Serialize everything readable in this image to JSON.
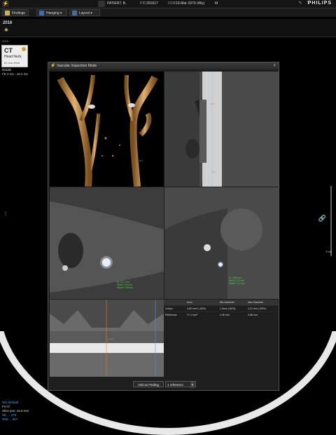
{
  "topbar": {
    "patient_name": "PATIENT, B.",
    "pid_label": "PID",
    "pid_value": "201617",
    "dob_label": "DOB",
    "dob_value": "10-Mar-1970 (46y)",
    "sex": "M",
    "brand": "PHILIPS",
    "help": "?"
  },
  "toolbar": {
    "findings": "Findings",
    "hanging": "Hanging",
    "layout": "Layout"
  },
  "timeline": {
    "year": "2016",
    "sub_year": "2016"
  },
  "study": {
    "modality": "CT",
    "desc": "Head Neck",
    "date": "01 Jun 2016"
  },
  "overlay_top": {
    "line1": "DIS2D",
    "line2": "FE 2 ms - 18.4 ms"
  },
  "overlay_bottom": {
    "wl": "W/L Default",
    "fh": "FH 0°",
    "slice": "Slice pos: 16.9 mm",
    "wl_val": "WL ... 379",
    "ww_val": "WW ... 867"
  },
  "scale_label": "5 cm",
  "dialog": {
    "title": "Vascular Inspection Mode",
    "close": "×",
    "pane_labels": {
      "mpr_blue": "Ref",
      "mpr_orange": "Lesion",
      "lower_orange": "Lesion"
    },
    "cross_left": [
      "Ar: 12.3 mm²",
      "MinØ: 3.96 mm",
      "MaxØ: 3.98 mm"
    ],
    "cross_right": [
      "Ar: 3.89 mm²",
      "MinØ: 2.21 mm",
      "MaxØ: 2.21 mm"
    ],
    "table": {
      "headers": [
        "",
        "Area",
        "Min Diameter",
        "Max Diameter"
      ],
      "rows": [
        [
          "Lesion",
          "3.89 mm² (-82%)",
          "1.8mm (-60%)",
          "2.21 mm (-55%)"
        ],
        [
          "Reference",
          "17.1 mm²",
          "4.46 mm",
          "4.86 mm"
        ]
      ]
    },
    "add_finding": "Add as Finding",
    "reference_select": "1 reference"
  }
}
